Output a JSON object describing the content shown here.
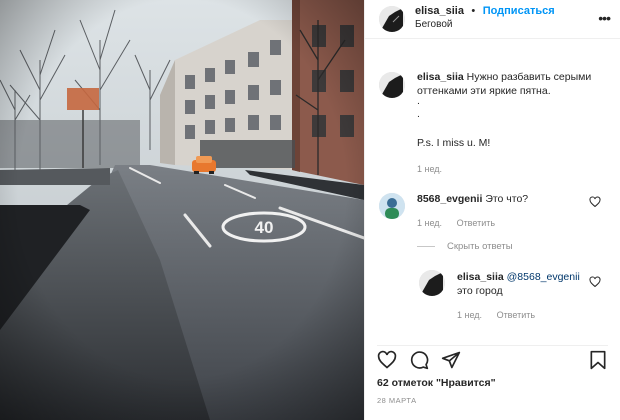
{
  "header": {
    "username": "elisa_siia",
    "separator": "•",
    "follow_label": "Подписаться",
    "location": "Беговой",
    "more_glyph": "•••"
  },
  "caption": {
    "username": "elisa_siia",
    "line1": "Нужно разбавить серыми",
    "line2": "оттенками эти яркие пятна.",
    "dot1": ".",
    "dot2": ".",
    "ps": "P.s. I miss u. M!",
    "time": "1 нед."
  },
  "comment1": {
    "username": "8568_evgenii",
    "text": "Это что?",
    "time": "1 нед.",
    "reply_label": "Ответить"
  },
  "hide_replies_label": "Скрыть ответы",
  "reply1": {
    "username": "elisa_siia",
    "mention": "@8568_evgenii",
    "text": "это город",
    "time": "1 нед.",
    "reply_label": "Ответить"
  },
  "likes_text": "62 отметок \"Нравится\"",
  "date_text": "28 МАРТА",
  "road_marking": "40",
  "icons": {
    "like": "heart-icon",
    "comment": "comment-icon",
    "share": "share-icon",
    "save": "bookmark-icon",
    "more": "more-icon"
  },
  "colors": {
    "follow": "#0095f6",
    "mention": "#00376b",
    "muted": "#8e8e8e",
    "car": "#e8782e"
  }
}
